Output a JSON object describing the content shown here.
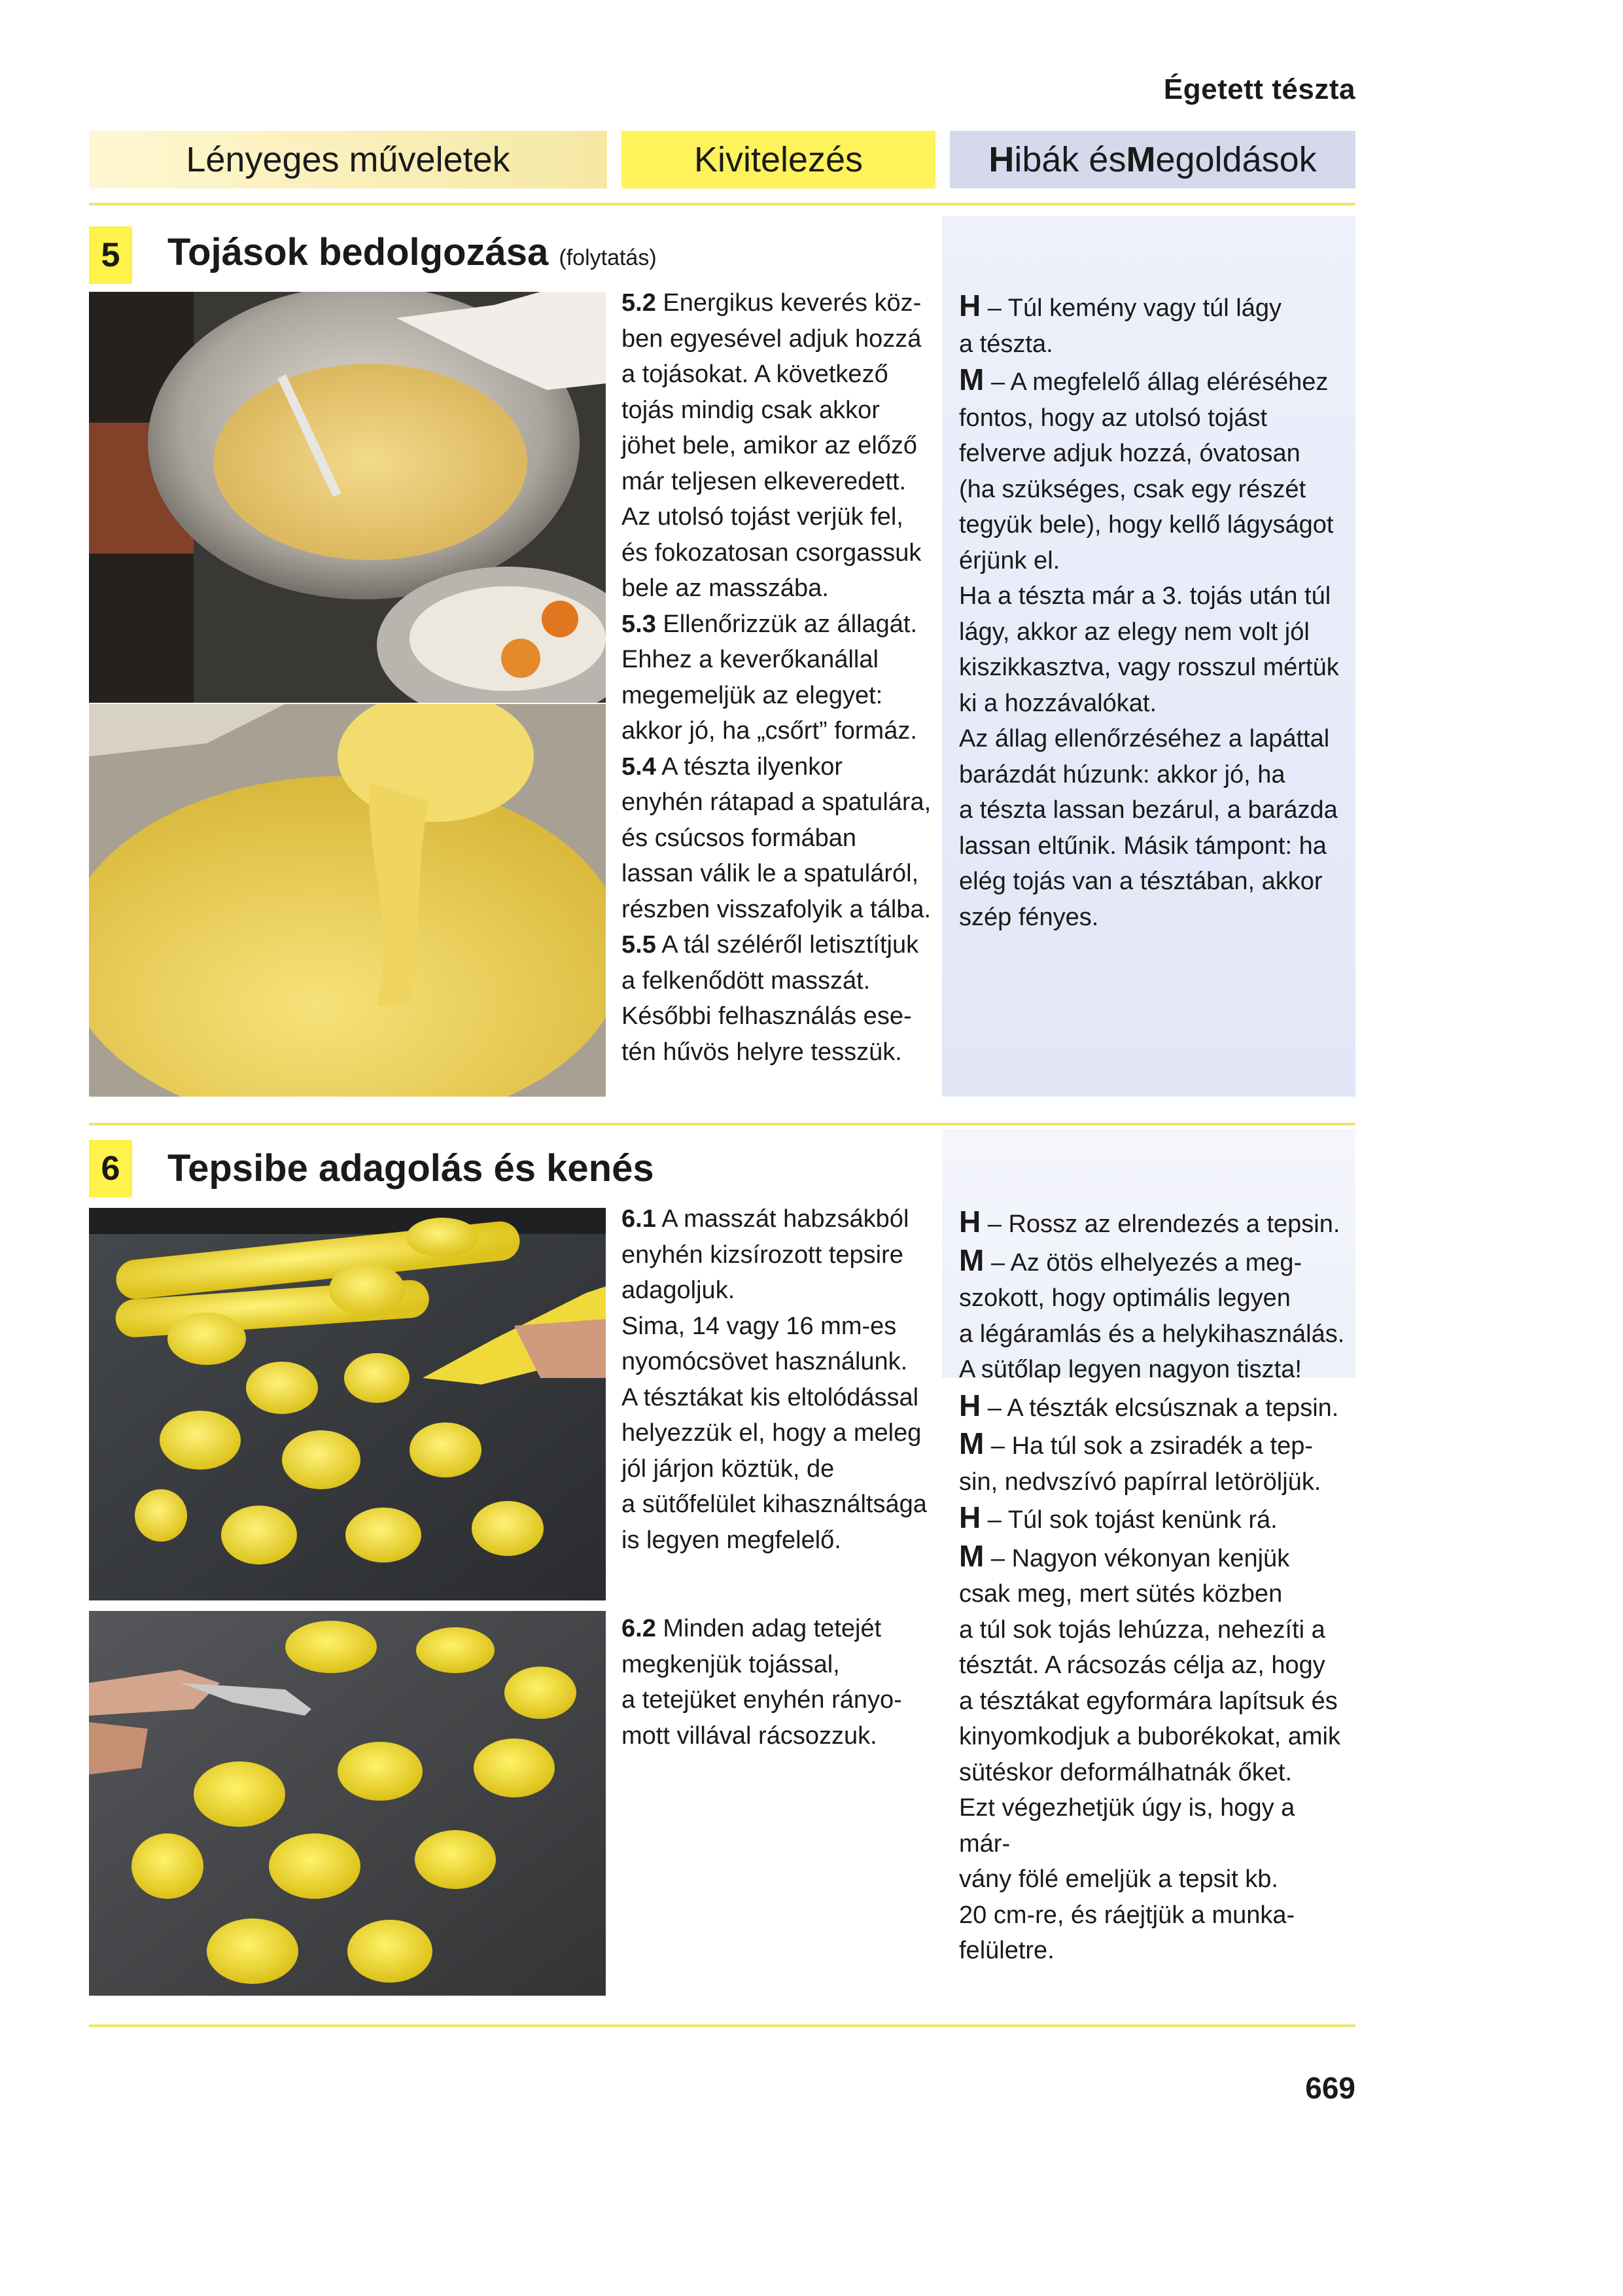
{
  "chapter": "Égetett tészta",
  "headers": {
    "col1": "Lényeges műveletek",
    "col2": "Kivitelezés",
    "col3_a": "H",
    "col3_b": "ibák és ",
    "col3_c": "M",
    "col3_d": "egoldások"
  },
  "section5": {
    "number": "5",
    "title": "Tojások bedolgozása",
    "title_suffix": "(folytatás)",
    "steps": [
      {
        "id": "5.2",
        "lines": [
          "Energikus keverés köz-",
          "ben egyesével adjuk hozzá",
          "a tojásokat. A következő",
          "tojás mindig csak akkor",
          "jöhet bele, amikor az előző",
          "már teljesen elkeveredett.",
          "Az utolsó tojást verjük fel,",
          "és fokozatosan csorgassuk",
          "bele az masszába."
        ]
      },
      {
        "id": "5.3",
        "lines": [
          "Ellenőrizzük az állagát.",
          "Ehhez a keverőkanállal",
          "megemeljük az elegyet:",
          "akkor jó, ha „csőrt” formáz."
        ]
      },
      {
        "id": "5.4",
        "lines": [
          "A tészta ilyenkor",
          "enyhén rátapad a spatulára,",
          "és csúcsos formában",
          "lassan válik le a spatuláról,",
          "részben visszafolyik a tálba."
        ]
      },
      {
        "id": "5.5",
        "lines": [
          "A tál széléről letisztítjuk",
          "a felkenődött masszát.",
          "Későbbi felhasználás ese-",
          "tén hűvös helyre tesszük."
        ]
      }
    ],
    "hm": [
      {
        "label": "H",
        "lines": [
          "– Túl kemény vagy túl lágy",
          "a tészta."
        ]
      },
      {
        "label": "M",
        "lines": [
          "– A megfelelő állag eléréséhez",
          "fontos, hogy az utolsó tojást",
          "felverve adjuk hozzá, óvatosan",
          "(ha szükséges, csak egy részét",
          "tegyük bele), hogy kellő lágyságot",
          "érjünk el.",
          "Ha a tészta már a 3. tojás után túl",
          "lágy, akkor az elegy nem volt jól",
          "kiszikkasztva, vagy rosszul mértük",
          "ki a hozzávalókat.",
          "Az állag ellenőrzéséhez a lapáttal",
          "barázdát húzunk: akkor jó, ha",
          "a tészta lassan bezárul, a barázda",
          "lassan eltűnik. Másik támpont: ha",
          "elég tojás van a tésztában, akkor",
          "szép fényes."
        ]
      }
    ]
  },
  "section6": {
    "number": "6",
    "title": "Tepsibe adagolás és kenés",
    "steps": [
      {
        "id": "6.1",
        "lines": [
          "A masszát habzsákból",
          "enyhén kizsírozott tepsire",
          "adagoljuk.",
          "Sima, 14 vagy 16 mm-es",
          "nyomócsövet használunk.",
          "A tésztákat kis eltolódással",
          "helyezzük el, hogy a meleg",
          "jól járjon köztük, de",
          "a sütőfelület kihasználtsága",
          "is legyen megfelelő."
        ]
      },
      {
        "id": "6.2",
        "lines": [
          "Minden adag tetejét",
          "megkenjük tojással,",
          "a tetejüket enyhén rányo-",
          "mott villával rácsozzuk."
        ]
      }
    ],
    "hm": [
      {
        "label": "H",
        "lines": [
          "– Rossz az elrendezés a tepsin."
        ]
      },
      {
        "label": "M",
        "lines": [
          "– Az ötös elhelyezés a meg-",
          "szokott, hogy optimális legyen",
          "a légáramlás és a helykihasználás.",
          "A sütőlap legyen nagyon tiszta!"
        ]
      },
      {
        "label": "H",
        "lines": [
          "– A tészták elcsúsznak a tepsin."
        ]
      },
      {
        "label": "M",
        "lines": [
          "– Ha túl sok a zsiradék a tep-",
          "sin, nedvszívó papírral letöröljük."
        ]
      },
      {
        "label": "H",
        "lines": [
          "– Túl sok tojást kenünk rá."
        ]
      },
      {
        "label": "M",
        "lines": [
          "– Nagyon vékonyan kenjük",
          "csak meg, mert sütés közben",
          "a túl sok tojás lehúzza, nehezíti a",
          "tésztát. A rácsozás célja az, hogy",
          "a tésztákat egyformára lapítsuk és",
          "kinyomkodjuk a buborékokat, amik",
          "sütéskor deformálhatnák őket.",
          "Ezt végezhetjük úgy is, hogy a már-",
          "vány fölé emeljük a tepsit kb.",
          "20 cm-re, és ráejtjük a munka-",
          "felületre."
        ]
      }
    ]
  },
  "page_number": "669"
}
